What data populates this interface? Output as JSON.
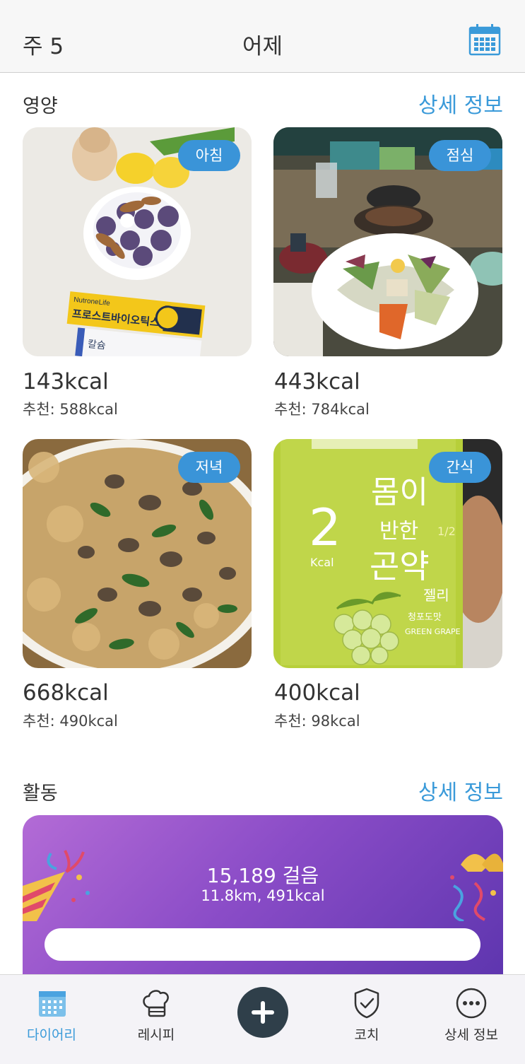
{
  "header": {
    "week": "주 5",
    "title": "어제",
    "calendar_icon": "calendar-icon"
  },
  "nutrition": {
    "title": "영양",
    "detail_label": "상세 정보",
    "meals": [
      {
        "badge": "아침",
        "kcal": "143kcal",
        "recommended": "추천: 588kcal",
        "photo_text_1": "NutroneLife",
        "photo_text_2": "프로스트바이오틱스",
        "photo_text_3": "칼슘"
      },
      {
        "badge": "점심",
        "kcal": "443kcal",
        "recommended": "추천: 784kcal"
      },
      {
        "badge": "저녁",
        "kcal": "668kcal",
        "recommended": "추천: 490kcal"
      },
      {
        "badge": "간식",
        "kcal": "400kcal",
        "recommended": "추천: 98kcal",
        "photo_text_1": "몸이",
        "photo_text_2": "반한",
        "photo_text_3": "곤약",
        "photo_text_4": "젤리",
        "photo_text_5": "2",
        "photo_text_6": "Kcal",
        "photo_text_7": "GREEN GRAPE",
        "photo_text_8": "1/2",
        "photo_text_9": "청포도맛"
      }
    ]
  },
  "activity": {
    "title": "활동",
    "detail_label": "상세 정보",
    "steps": "15,189 걸음",
    "summary": "11.8km, 491kcal"
  },
  "tabbar": {
    "items": [
      {
        "label": "다이어리",
        "icon": "calendar-icon",
        "active": true
      },
      {
        "label": "레시피",
        "icon": "chef-hat-icon",
        "active": false
      },
      {
        "label": "",
        "icon": "plus-icon",
        "active": false
      },
      {
        "label": "코치",
        "icon": "shield-check-icon",
        "active": false
      },
      {
        "label": "상세 정보",
        "icon": "more-icon",
        "active": false
      }
    ]
  },
  "colors": {
    "accent": "#3a9ad9",
    "badge": "#3a94d8",
    "activity_gradient_start": "#b36bd6",
    "activity_gradient_end": "#5b34ad",
    "add_button": "#2f3f4a"
  }
}
